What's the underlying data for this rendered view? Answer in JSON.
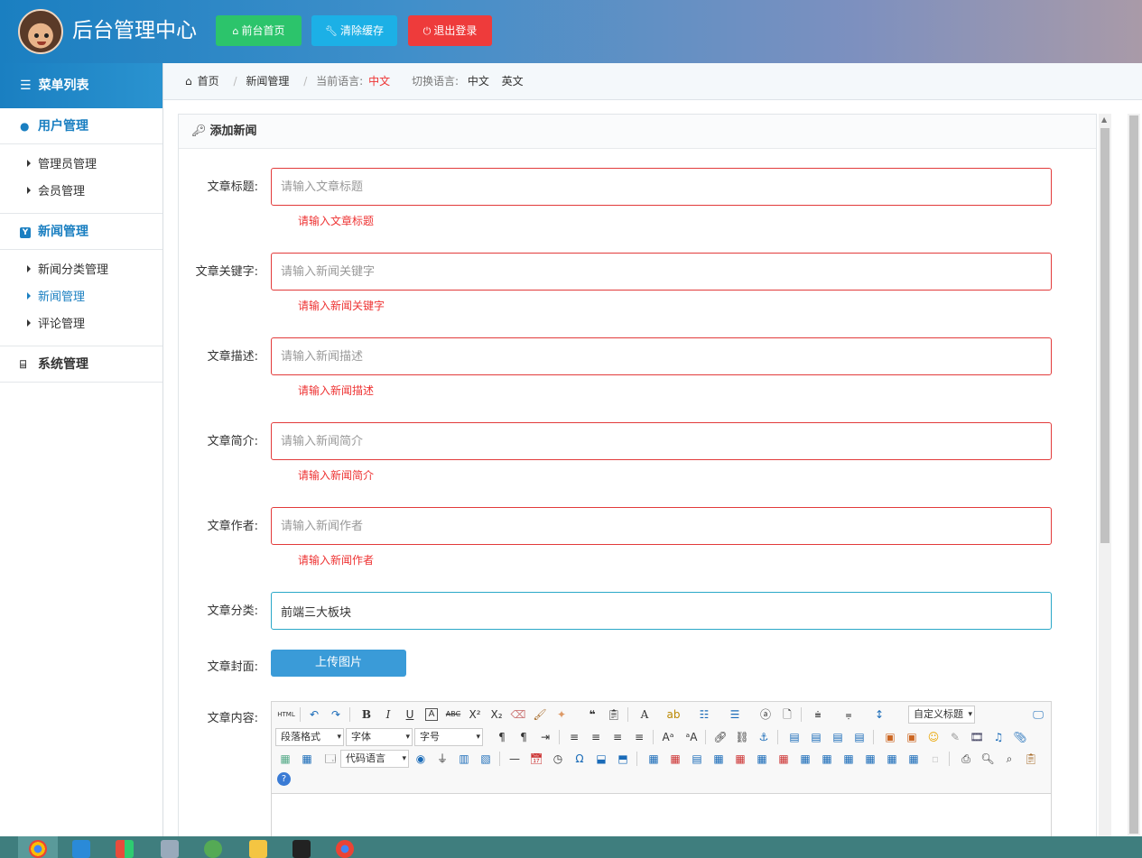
{
  "header": {
    "title": "后台管理中心",
    "btn_home": "前台首页",
    "btn_cache": "清除缓存",
    "btn_logout": "退出登录"
  },
  "sidebar": {
    "menu_title": "菜单列表",
    "groups": [
      {
        "label": "用户管理",
        "items": [
          "管理员管理",
          "会员管理"
        ]
      },
      {
        "label": "新闻管理",
        "items": [
          "新闻分类管理",
          "新闻管理",
          "评论管理"
        ],
        "active_item": "新闻管理"
      },
      {
        "label": "系统管理"
      }
    ]
  },
  "breadcrumb": {
    "home": "首页",
    "current": "新闻管理",
    "lang_label": "当前语言:",
    "lang_value": "中文",
    "switch_label": "切换语言:",
    "lang_cn": "中文",
    "lang_en": "英文"
  },
  "panel": {
    "title": "添加新闻"
  },
  "form": {
    "title": {
      "label": "文章标题:",
      "placeholder": "请输入文章标题",
      "error": "请输入文章标题"
    },
    "keywords": {
      "label": "文章关键字:",
      "placeholder": "请输入新闻关键字",
      "error": "请输入新闻关键字"
    },
    "desc": {
      "label": "文章描述:",
      "placeholder": "请输入新闻描述",
      "error": "请输入新闻描述"
    },
    "intro": {
      "label": "文章简介:",
      "placeholder": "请输入新闻简介",
      "error": "请输入新闻简介"
    },
    "author": {
      "label": "文章作者:",
      "placeholder": "请输入新闻作者",
      "error": "请输入新闻作者"
    },
    "category": {
      "label": "文章分类:",
      "value": "前端三大板块"
    },
    "cover": {
      "label": "文章封面:",
      "button": "上传图片"
    },
    "content": {
      "label": "文章内容:"
    }
  },
  "editor": {
    "html_btn": "HTML",
    "custom_title": "自定义标题",
    "paragraph": "段落格式",
    "font": "字体",
    "size": "字号",
    "code_lang": "代码语言"
  }
}
